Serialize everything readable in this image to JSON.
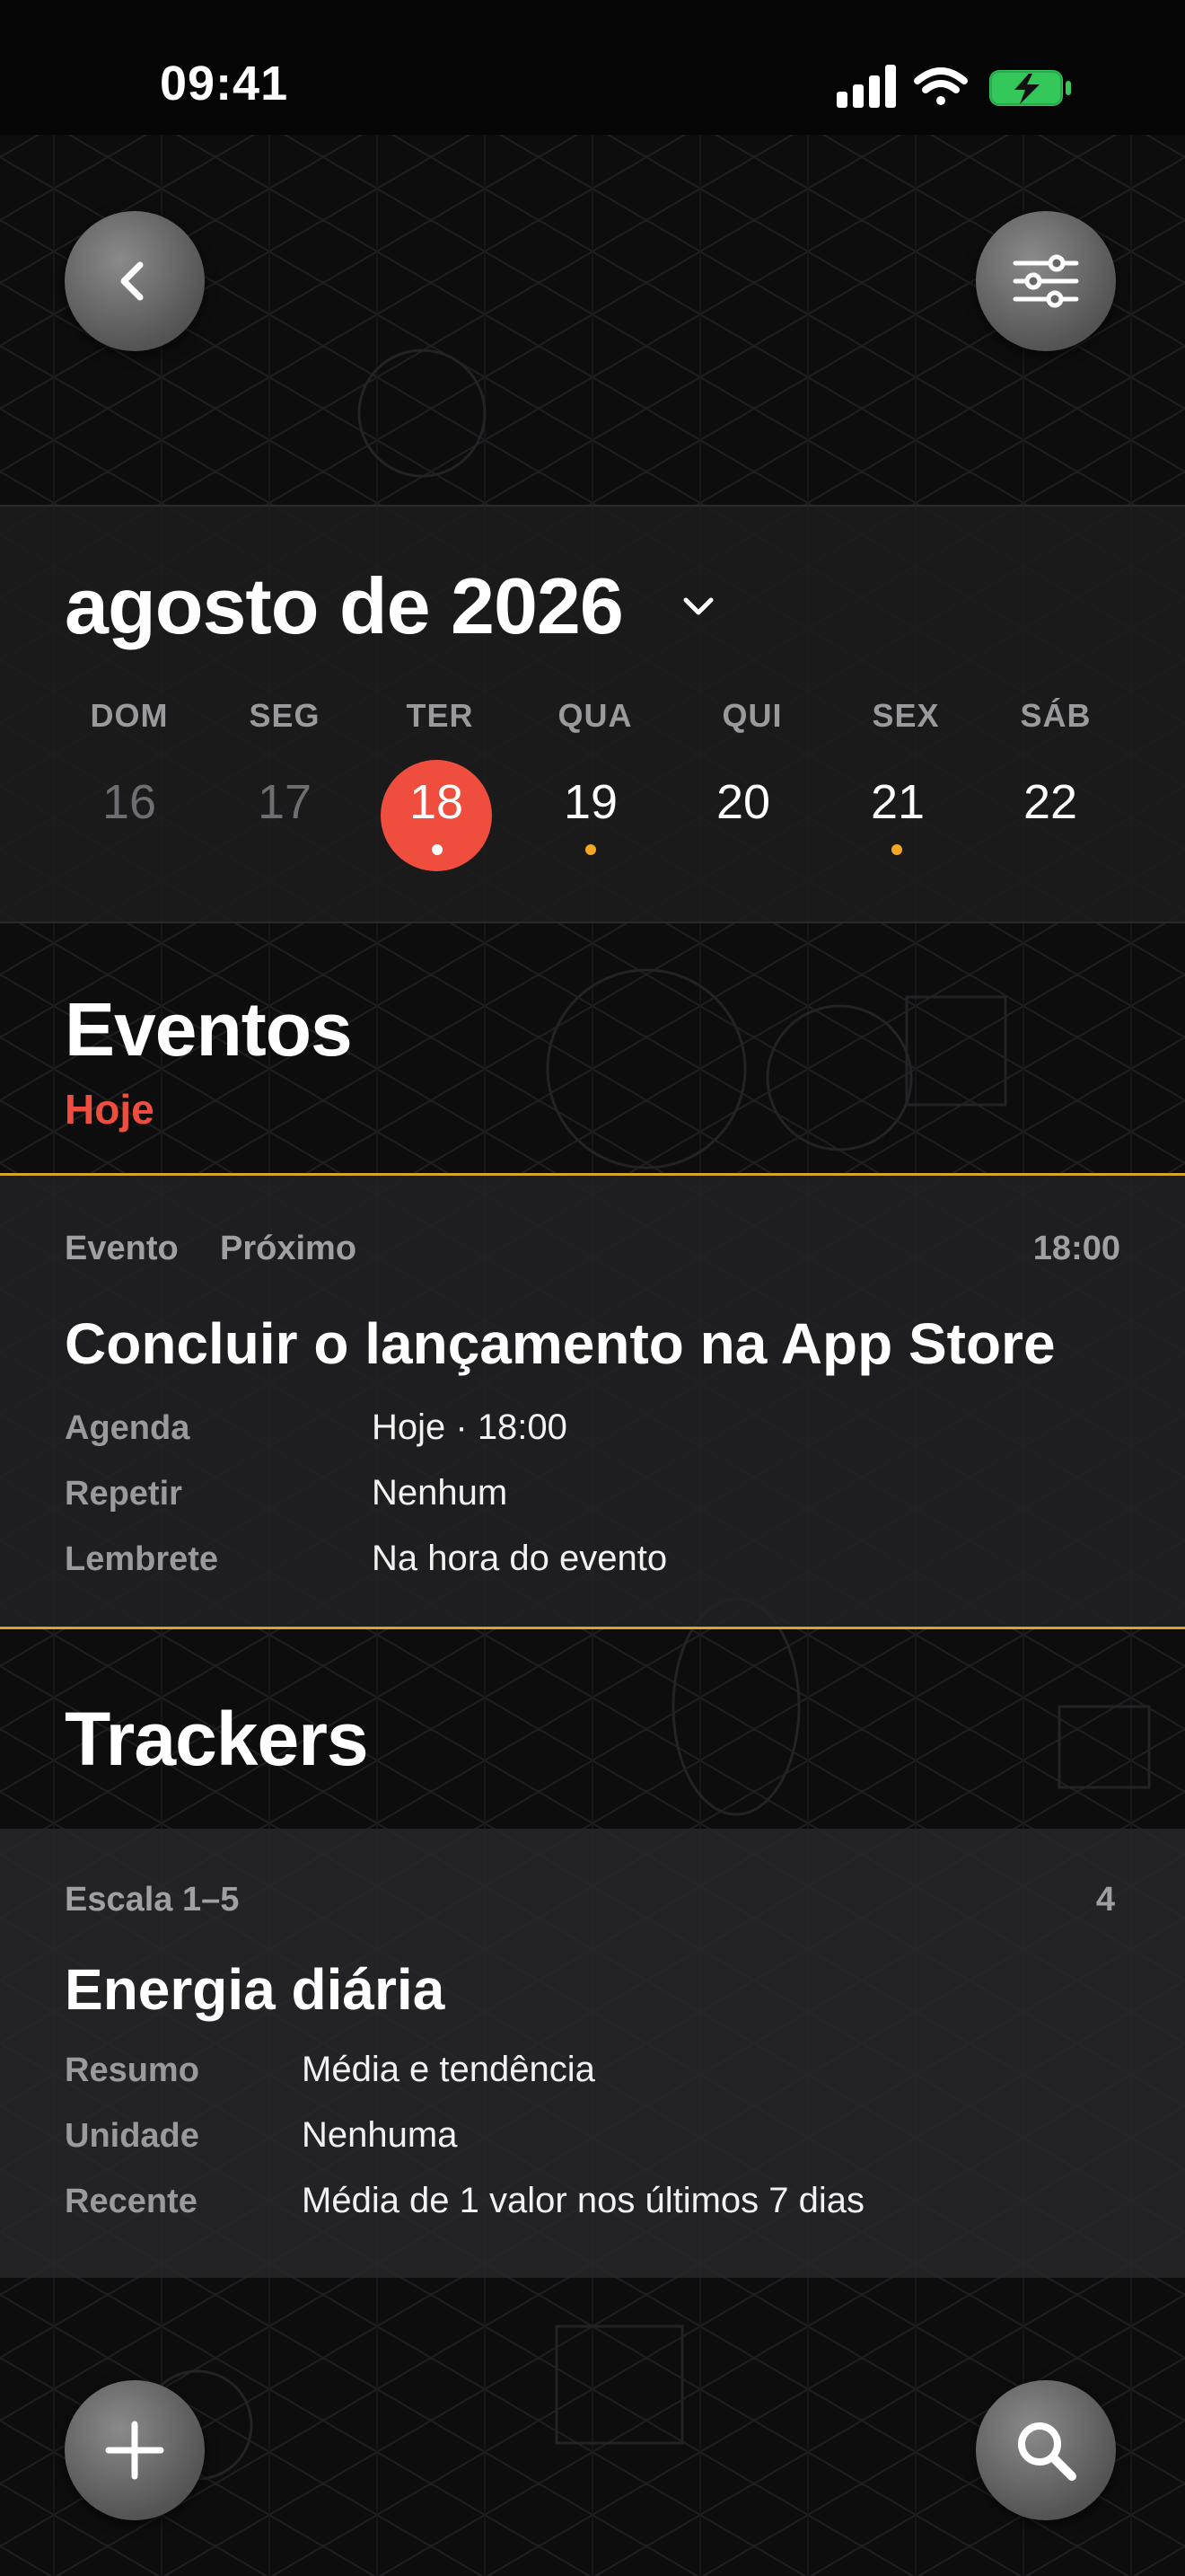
{
  "status_bar": {
    "time": "09:41"
  },
  "header": {
    "back_icon": "chevron-left-icon",
    "filter_icon": "sliders-icon"
  },
  "calendar": {
    "month_title": "agosto de 2026",
    "weekdays": [
      "DOM",
      "SEG",
      "TER",
      "QUA",
      "QUI",
      "SEX",
      "SÁB"
    ],
    "days": [
      "16",
      "17",
      "18",
      "19",
      "20",
      "21",
      "22"
    ],
    "selected_day": "18",
    "selected_color": "#ef4d3d",
    "event_dot_color": "#f5a623"
  },
  "events": {
    "section_title": "Eventos",
    "subtitle": "Hoje",
    "card": {
      "type": "Evento",
      "status": "Próximo",
      "time": "18:00",
      "title": "Concluir o lançamento na App Store",
      "rows": [
        {
          "label": "Agenda",
          "value": "Hoje · 18:00"
        },
        {
          "label": "Repetir",
          "value": "Nenhum"
        },
        {
          "label": "Lembrete",
          "value": "Na hora do evento"
        }
      ],
      "border_color": "#d4a52a"
    }
  },
  "trackers": {
    "section_title": "Trackers",
    "card": {
      "scale": "Escala 1–5",
      "value": "4",
      "title": "Energia diária",
      "rows": [
        {
          "label": "Resumo",
          "value": "Média e tendência"
        },
        {
          "label": "Unidade",
          "value": "Nenhuma"
        },
        {
          "label": "Recente",
          "value": "Média de 1 valor nos últimos 7 dias"
        }
      ]
    }
  },
  "bottom_bar": {
    "add_icon": "plus-icon",
    "search_icon": "magnifier-icon"
  }
}
